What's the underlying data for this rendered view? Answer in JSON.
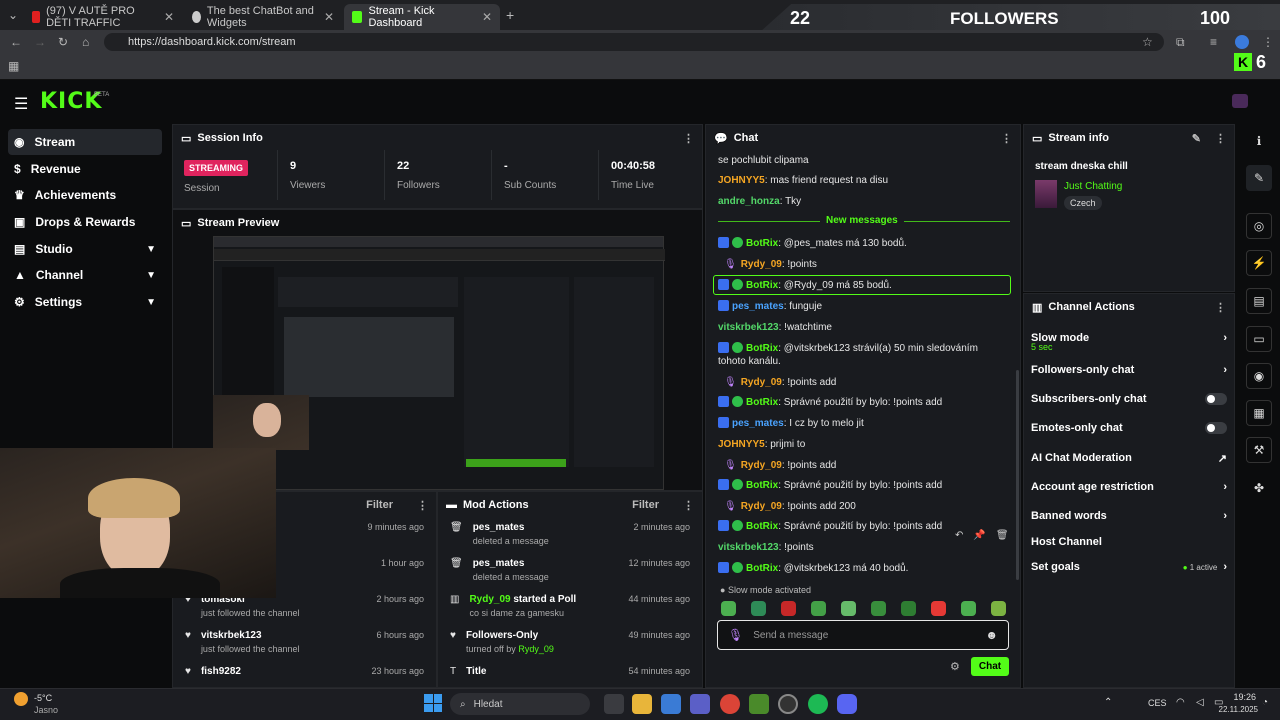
{
  "browser": {
    "tabs": [
      {
        "label": "(97) V AUTĚ PRO DĚTI TRAFFIC",
        "active": false
      },
      {
        "label": "The best ChatBot and Widgets",
        "active": false
      },
      {
        "label": "Stream - Kick Dashboard",
        "active": true
      }
    ],
    "url": "https://dashboard.kick.com/stream"
  },
  "overlay": {
    "count": "22",
    "label": "FOLLOWERS",
    "goal": "100",
    "side_count": "6"
  },
  "brand": {
    "logo": "KICK",
    "beta": "BETA",
    "accent": "#53fc18"
  },
  "sidebar": {
    "items": [
      {
        "label": "Stream",
        "icon": "stream-icon"
      },
      {
        "label": "Revenue",
        "icon": "revenue-icon"
      },
      {
        "label": "Achievements",
        "icon": "trophy-icon"
      },
      {
        "label": "Drops & Rewards",
        "icon": "gift-icon"
      },
      {
        "label": "Studio",
        "icon": "studio-icon"
      },
      {
        "label": "Channel",
        "icon": "channel-icon"
      },
      {
        "label": "Settings",
        "icon": "gear-icon"
      }
    ]
  },
  "session": {
    "title": "Session Info",
    "status": "STREAMING",
    "status_label": "Session",
    "stats": [
      {
        "value": "9",
        "label": "Viewers"
      },
      {
        "value": "22",
        "label": "Followers"
      },
      {
        "value": "-",
        "label": "Sub Counts"
      },
      {
        "value": "00:40:58",
        "label": "Time Live"
      }
    ]
  },
  "preview": {
    "title": "Stream Preview"
  },
  "activity": {
    "filter": "Filter",
    "items": [
      {
        "name": "",
        "desc": "channel",
        "time": "9 minutes ago"
      },
      {
        "name": "",
        "desc": "channel",
        "time": "1 hour ago"
      },
      {
        "name": "tomasoki",
        "desc": "just followed the channel",
        "time": "2 hours ago"
      },
      {
        "name": "vitskrbek123",
        "desc": "just followed the channel",
        "time": "6 hours ago"
      },
      {
        "name": "fish9282",
        "desc": "",
        "time": "23 hours ago"
      }
    ]
  },
  "mod": {
    "title": "Mod Actions",
    "filter": "Filter",
    "items": [
      {
        "name": "pes_mates",
        "desc": "deleted a message",
        "time": "2 minutes ago"
      },
      {
        "name": "pes_mates",
        "desc": "deleted a message",
        "time": "12 minutes ago"
      },
      {
        "name": "Rydy_09",
        "extra": "started a Poll",
        "desc": "co si dame za gamesku",
        "time": "44 minutes ago"
      },
      {
        "name": "Followers-Only",
        "desc": "turned off by",
        "by": "Rydy_09",
        "time": "49 minutes ago"
      },
      {
        "name": "Title",
        "desc": "",
        "time": "54 minutes ago"
      }
    ]
  },
  "chat": {
    "title": "Chat",
    "new_messages": "New messages",
    "slow_mode": "Slow mode activated",
    "placeholder": "Send a message",
    "send": "Chat",
    "messages": [
      {
        "user": "",
        "text": "se pochlubit clipama",
        "color": "#e6e6e6"
      },
      {
        "user": "JOHNYY5",
        "text": ": mas friend request na disu",
        "color": "#f5a623"
      },
      {
        "user": "andre_honza",
        "text": ": Tky",
        "color": "#53d769"
      },
      {
        "user": "BotRix",
        "text": ": @pes_mates má 130 bodů.",
        "color": "#53fc18",
        "bot": true
      },
      {
        "user": "Rydy_09",
        "text": ": !points",
        "color": "#f5a623",
        "mod": true
      },
      {
        "user": "BotRix",
        "text": ": @Rydy_09 má 85 bodů.",
        "color": "#53fc18",
        "bot": true,
        "highlight": true
      },
      {
        "user": "pes_mates",
        "text": ": funguje",
        "color": "#4aa3ff",
        "mod2": true
      },
      {
        "user": "vitskrbek123",
        "text": ": !watchtime",
        "color": "#53d769"
      },
      {
        "user": "BotRix",
        "text": ": @vitskrbek123 strávil(a) 50 min sledováním tohoto kanálu.",
        "color": "#53fc18",
        "bot": true
      },
      {
        "user": "Rydy_09",
        "text": ": !points add",
        "color": "#f5a623",
        "mod": true
      },
      {
        "user": "BotRix",
        "text": ": Správné použití by bylo: !points add",
        "color": "#53fc18",
        "bot": true
      },
      {
        "user": "pes_mates",
        "text": ": I cz by to melo jit",
        "color": "#4aa3ff",
        "mod2": true
      },
      {
        "user": "JOHNYY5",
        "text": ": prijmi to",
        "color": "#f5a623"
      },
      {
        "user": "Rydy_09",
        "text": ": !points add",
        "color": "#f5a623",
        "mod": true
      },
      {
        "user": "BotRix",
        "text": ": Správné použití by bylo: !points add",
        "color": "#53fc18",
        "bot": true
      },
      {
        "user": "Rydy_09",
        "text": ": !points add 200",
        "color": "#f5a623",
        "mod": true
      },
      {
        "user": "BotRix",
        "text": ": Správné použití by bylo: !points add",
        "color": "#53fc18",
        "bot": true
      },
      {
        "user": "vitskrbek123",
        "text": ": !points",
        "color": "#53d769"
      },
      {
        "user": "BotRix",
        "text": ": @vitskrbek123 má 40 bodů.",
        "color": "#53fc18",
        "bot": true
      }
    ]
  },
  "stream_info": {
    "title": "Stream info",
    "stream_title": "stream dneska chill",
    "category": "Just Chatting",
    "tag": "Czech"
  },
  "channel_actions": {
    "title": "Channel Actions",
    "items": [
      {
        "label": "Slow mode",
        "sub": "5 sec",
        "ctrl": "chevron"
      },
      {
        "label": "Followers-only chat",
        "ctrl": "chevron"
      },
      {
        "label": "Subscribers-only chat",
        "ctrl": "toggle"
      },
      {
        "label": "Emotes-only chat",
        "ctrl": "toggle"
      },
      {
        "label": "AI Chat Moderation",
        "ctrl": "external"
      },
      {
        "label": "Account age restriction",
        "ctrl": "chevron"
      },
      {
        "label": "Banned words",
        "ctrl": "chevron"
      },
      {
        "label": "Host Channel",
        "ctrl": "none"
      },
      {
        "label": "Set goals",
        "ctrl": "chevron",
        "status": "1 active"
      }
    ]
  },
  "taskbar": {
    "weather_temp": "-5°C",
    "weather_desc": "Jasno",
    "search": "Hledat",
    "lang": "CES",
    "time": "19:26",
    "date": "22.11.2025"
  }
}
